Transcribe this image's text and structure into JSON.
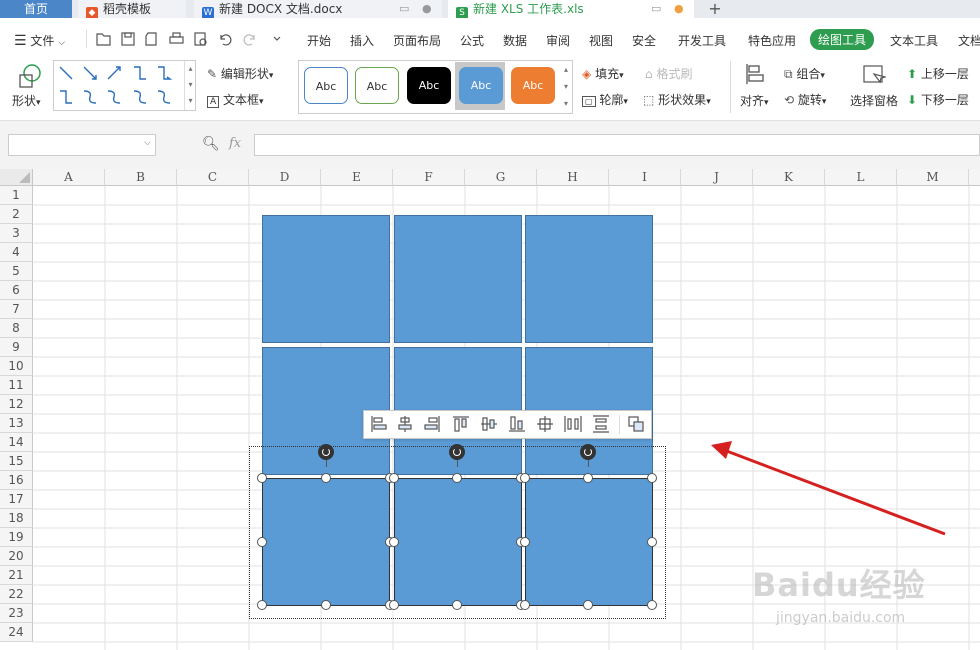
{
  "tabs": {
    "home": "首页",
    "daoke": "稻壳模板",
    "doc": "新建 DOCX 文档.docx",
    "xls": "新建 XLS 工作表.xls",
    "new_tab": "+"
  },
  "menu": {
    "file": "文件",
    "items": [
      "开始",
      "插入",
      "页面布局",
      "公式",
      "数据",
      "审阅",
      "视图",
      "安全",
      "开发工具",
      "特色应用",
      "绘图工具",
      "文本工具",
      "文档"
    ]
  },
  "ribbon": {
    "shape_label": "形状",
    "edit_shape": "编辑形状",
    "text_box": "文本框",
    "style_sample": "Abc",
    "fill": "填充",
    "format_painter": "格式刷",
    "outline": "轮廓",
    "shape_effect": "形状效果",
    "align": "对齐",
    "group": "组合",
    "rotate": "旋转",
    "selection_pane": "选择窗格",
    "bring_forward": "上移一层",
    "send_backward": "下移一层"
  },
  "formula_bar": {
    "name_box": "",
    "fx": "fx",
    "formula": ""
  },
  "columns": [
    "A",
    "B",
    "C",
    "D",
    "E",
    "F",
    "G",
    "H",
    "I",
    "J",
    "K",
    "L",
    "M"
  ],
  "rows": [
    "1",
    "2",
    "3",
    "4",
    "5",
    "6",
    "7",
    "8",
    "9",
    "10",
    "11",
    "12",
    "13",
    "14",
    "15",
    "16",
    "17",
    "18",
    "19",
    "20",
    "21",
    "22",
    "23",
    "24"
  ],
  "colors": {
    "accent_green": "#2e9d4f",
    "shape_fill": "#5b9bd5",
    "shape_border": "#41719c",
    "arrow": "#d62020",
    "style_orange": "#ed7d31"
  },
  "watermark": {
    "brand": "Baidu经验",
    "url": "jingyan.baidu.com"
  }
}
